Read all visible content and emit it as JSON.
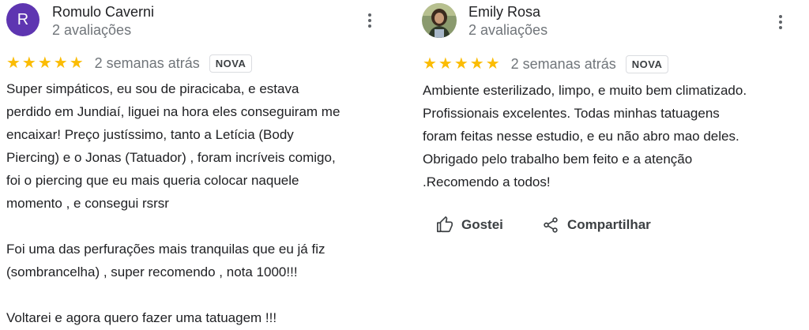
{
  "reviews": [
    {
      "avatar_letter": "R",
      "avatar_color": "#5e35b1",
      "name": "Romulo Caverni",
      "review_count": "2 avaliações",
      "stars": "★★★★★",
      "time_ago": "2 semanas atrás",
      "badge": "NOVA",
      "text_lines": [
        "Super simpáticos, eu sou de piracicaba, e estava",
        "perdido em Jundiaí,  liguei na hora eles conseguiram me",
        "encaixar! Preço justíssimo, tanto a Letícia (Body",
        "Piercing) e o Jonas (Tatuador) , foram incríveis comigo,",
        "foi o piercing que eu mais queria colocar naquele",
        "momento , e consegui rsrsr",
        "Foi uma das perfurações mais tranquilas que eu já fiz",
        "(sombrancelha) , super recomendo , nota 1000!!!",
        "Voltarei e agora quero fazer uma tatuagem !!!"
      ]
    },
    {
      "name": "Emily Rosa",
      "review_count": "2 avaliações",
      "stars": "★★★★★",
      "time_ago": "2 semanas atrás",
      "badge": "NOVA",
      "text_lines": [
        "Ambiente esterilizado, limpo, e muito bem climatizado.",
        "Profissionais excelentes. Todas minhas tatuagens",
        "foram feitas nesse estudio, e eu não abro mao deles.",
        "Obrigado pelo trabalho bem feito e a atenção",
        ".Recomendo a todos!"
      ],
      "actions": {
        "like_label": "Gostei",
        "share_label": "Compartilhar"
      }
    }
  ],
  "colors": {
    "star": "#fbbc04",
    "secondary_text": "#70757a",
    "primary_text": "#202124"
  }
}
